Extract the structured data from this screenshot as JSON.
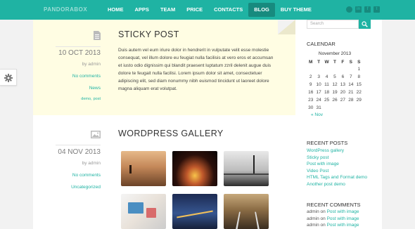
{
  "header": {
    "brand": "PANDORABOX",
    "nav": [
      "HOME",
      "APPS",
      "TEAM",
      "PRICE",
      "CONTACTS",
      "BLOG",
      "BUY THEME"
    ],
    "active_nav": "BLOG",
    "social_icons": [
      "dribbble-icon",
      "linkedin-icon",
      "facebook-icon",
      "twitter-icon"
    ]
  },
  "colors": {
    "accent": "#1fb3a3",
    "accent_dark": "#178a7e",
    "sticky_bg": "#fffde3"
  },
  "posts": [
    {
      "title": "STICKY POST",
      "date": "10 OCT 2013",
      "by": "by admin",
      "comments": "No comments",
      "category": "News",
      "tags": [
        "demo,",
        "post"
      ],
      "icon": "document-icon",
      "body": "Duis autem vel eum iriure dolor in hendrerit in vulputate velit esse molestie consequat, vel illum dolore eu feugiat nulla facilisis at vero eros et accumsan et iusto odio dignissim qui blandit praesent luptatum zzril delenit augue duis dolore te feugait nulla facilisi. Lorem ipsum dolor sit amet, consectetuer adipiscing elit, sed diam nonummy nibh euismod tincidunt ut laoreet dolore magna aliquam erat volutpat."
    },
    {
      "title": "WORDPRESS GALLERY",
      "date": "04 NOV 2013",
      "by": "by admin",
      "comments": "No comments",
      "category": "Uncategorized",
      "icon": "image-icon"
    }
  ],
  "sidebar": {
    "search_placeholder": "Search",
    "calendar": {
      "title": "CALENDAR",
      "caption": "November 2013",
      "days": [
        "M",
        "T",
        "W",
        "T",
        "F",
        "S",
        "S"
      ],
      "weeks": [
        [
          "",
          "",
          "",
          "",
          "",
          "",
          "1"
        ],
        [
          "2",
          "3",
          "4",
          "5",
          "6",
          "7",
          "8"
        ],
        [
          "9",
          "10",
          "11",
          "12",
          "13",
          "14",
          "15"
        ],
        [
          "16",
          "17",
          "18",
          "19",
          "20",
          "21",
          "22"
        ],
        [
          "23",
          "24",
          "25",
          "26",
          "27",
          "28",
          "29"
        ],
        [
          "30",
          "31",
          "",
          "",
          "",
          "",
          ""
        ]
      ],
      "prev": "« Nov"
    },
    "recent_posts": {
      "title": "RECENT POSTS",
      "items": [
        "WordPress gallery",
        "Sticky post",
        "Post with image",
        "Video Post",
        "HTML Tags and Format demo",
        "Another post demo"
      ]
    },
    "recent_comments": {
      "title": "RECENT COMMENTS",
      "items": [
        {
          "author": "admin",
          "on": "on",
          "post": "Post with image"
        },
        {
          "author": "admin",
          "on": "on",
          "post": "Post with image"
        },
        {
          "author": "admin",
          "on": "on",
          "post": "Post with image"
        }
      ]
    }
  }
}
